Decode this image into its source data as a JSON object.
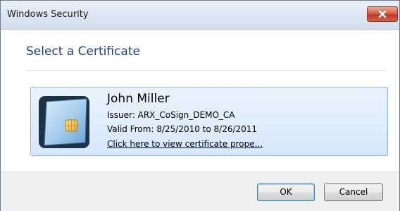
{
  "window": {
    "title": "Windows Security"
  },
  "dialog": {
    "heading": "Select a Certificate"
  },
  "certificate": {
    "name": "John Miller",
    "issuer": "Issuer: ARX_CoSign_DEMO_CA",
    "valid": "Valid From: 8/25/2010 to 8/26/2011",
    "link": "Click here to view certificate prope..."
  },
  "buttons": {
    "ok": "OK",
    "cancel": "Cancel"
  },
  "colors": {
    "heading": "#1e3f8a",
    "tile_bg": "#dbeafb",
    "tile_border": "#8fb6e0",
    "close_button": "#c0392b"
  },
  "icons": {
    "close": "close-icon",
    "certificate": "smart-card-icon"
  }
}
